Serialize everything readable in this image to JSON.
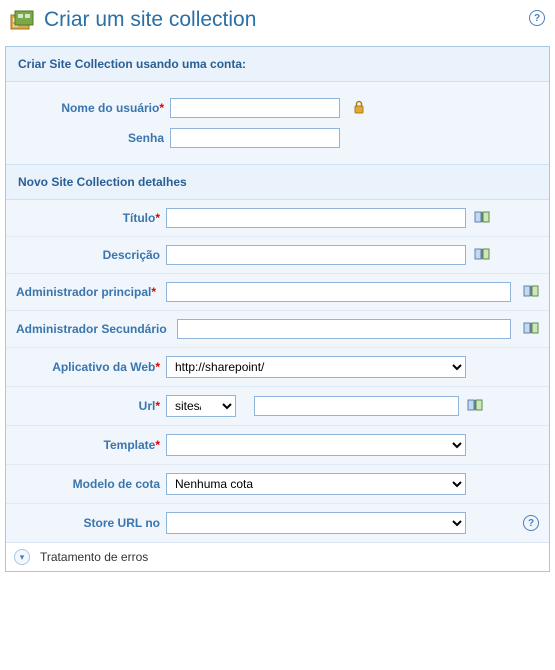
{
  "header": {
    "title": "Criar um site collection"
  },
  "section1": {
    "title": "Criar Site Collection usando uma conta:",
    "username_label": "Nome do usuário",
    "username_value": "",
    "password_label": "Senha",
    "password_value": ""
  },
  "section2": {
    "title": "Novo Site Collection detalhes",
    "titulo_label": "Título",
    "titulo_value": "",
    "descricao_label": "Descrição",
    "descricao_value": "",
    "admin_principal_label": "Administrador principal",
    "admin_principal_value": "",
    "admin_secundario_label": "Administrador Secundário",
    "admin_secundario_value": "",
    "app_web_label": "Aplicativo da Web",
    "app_web_value": "http://sharepoint/",
    "url_label": "Url",
    "url_path_value": "sites/",
    "url_name_value": "",
    "template_label": "Template",
    "template_value": "",
    "cota_label": "Modelo de cota",
    "cota_value": "Nenhuma cota",
    "store_label": "Store URL no",
    "store_value": ""
  },
  "footer": {
    "label": "Tratamento de erros"
  }
}
